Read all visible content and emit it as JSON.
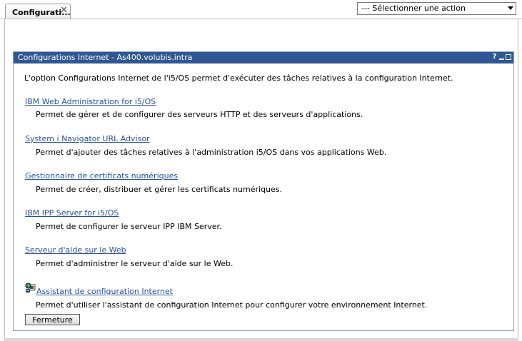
{
  "tab": {
    "label": "Configurati..."
  },
  "action_select": {
    "label": "--- Sélectionner une action"
  },
  "portlet": {
    "title": "Configurations Internet - As400.volubis.intra",
    "help": "?",
    "intro": "L'option Configurations Internet de l'i5/OS permet d'exécuter des tâches relatives à la configuration Internet.",
    "items": [
      {
        "link": "IBM Web Administration for i5/OS",
        "desc": "Permet de gérer et de configurer des serveurs HTTP et des serveurs d'applications."
      },
      {
        "link": "System i Navigator URL Advisor",
        "desc": "Permet d'ajouter des tâches relatives à l'administration i5/OS dans vos applications Web."
      },
      {
        "link": "Gestionnaire de certificats numériques",
        "desc": "Permet de créer, distribuer et gérer les certificats numériques."
      },
      {
        "link": "IBM IPP Server for i5/OS",
        "desc": "Permet de configurer le serveur IPP IBM Server."
      },
      {
        "link": "Serveur d'aide sur le Web",
        "desc": "Permet d'administrer le serveur d'aide sur le Web."
      },
      {
        "link": "Assistant de configuration Internet",
        "desc": "Permet d'utiliser l'assistant de configuration Internet pour configurer votre environnement Internet."
      }
    ],
    "close_label": "Fermeture"
  },
  "colors": {
    "title_bar": "#2f5793",
    "link": "#26529b"
  },
  "icons": {
    "tab_close": "close-icon",
    "wizard": "wizard-icon"
  }
}
